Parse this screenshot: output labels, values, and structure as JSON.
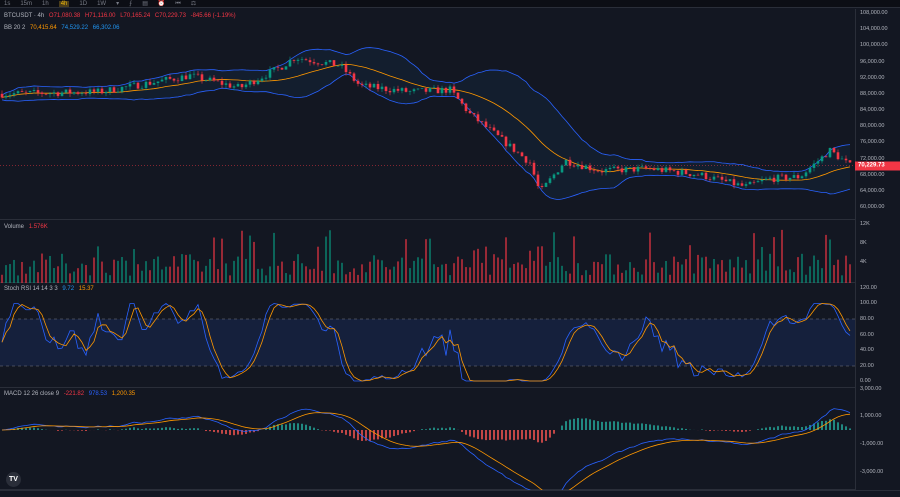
{
  "toolbar": {
    "intervals": [
      "1s",
      "15m",
      "1h",
      "4h",
      "1D",
      "1W"
    ],
    "active_interval": "4h",
    "dropdown": "▾",
    "tools": [
      "indicators-icon",
      "templates-icon",
      "alert-icon",
      "replay-icon",
      "compare-icon"
    ]
  },
  "header": {
    "symbol": "BTCUSDT · 4h",
    "open": "O71,080.38",
    "high": "H71,116.00",
    "low": "L70,165.24",
    "close": "C70,229.73",
    "change": "-845.66 (-1.19%)"
  },
  "bb": {
    "label": "BB 20 2",
    "basis": "70,415.64",
    "upper": "74,529.22",
    "lower": "66,302.06"
  },
  "volume": {
    "label": "Volume",
    "value": "1.576K",
    "ticks": [
      "12K",
      "8K",
      "4K"
    ]
  },
  "stoch": {
    "label": "Stoch RSI 14 14 3 3",
    "k": "9.72",
    "d": "15.37",
    "ticks": [
      "120.00",
      "100.00",
      "80.00",
      "60.00",
      "40.00",
      "20.00",
      "0.00"
    ]
  },
  "macd": {
    "label": "MACD 12 26 close 9",
    "hist": "-221.82",
    "macd": "978.53",
    "signal": "1,200.35",
    "ticks": [
      "3,000.00",
      "1,000.00",
      "-1,000.00",
      "-3,000.00"
    ]
  },
  "price_axis": {
    "ticks": [
      "108,000.00",
      "104,000.00",
      "100,000.00",
      "96,000.00",
      "92,000.00",
      "88,000.00",
      "84,000.00",
      "80,000.00",
      "76,000.00",
      "72,000.00",
      "68,000.00",
      "64,000.00",
      "60,000.00"
    ],
    "last_price": "70,229.73"
  },
  "logo": "TV",
  "colors": {
    "up": "#089981",
    "down": "#f23645",
    "bb_basis": "#ff9800",
    "bb_band": "#2196f3",
    "macd": "#2962ff",
    "signal": "#ff9800"
  },
  "price_path": [
    [
      0,
      88000
    ],
    [
      100,
      88500
    ],
    [
      190,
      92500
    ],
    [
      240,
      89500
    ],
    [
      280,
      94500
    ],
    [
      295,
      97000
    ],
    [
      340,
      95000
    ],
    [
      360,
      90000
    ],
    [
      410,
      88500
    ],
    [
      450,
      89000
    ],
    [
      470,
      83000
    ],
    [
      500,
      77000
    ],
    [
      530,
      71000
    ],
    [
      540,
      63500
    ],
    [
      565,
      71500
    ],
    [
      600,
      69000
    ],
    [
      650,
      69500
    ],
    [
      700,
      68000
    ],
    [
      745,
      65000
    ],
    [
      770,
      67000
    ],
    [
      800,
      67500
    ],
    [
      830,
      74000
    ],
    [
      850,
      70230
    ]
  ]
}
